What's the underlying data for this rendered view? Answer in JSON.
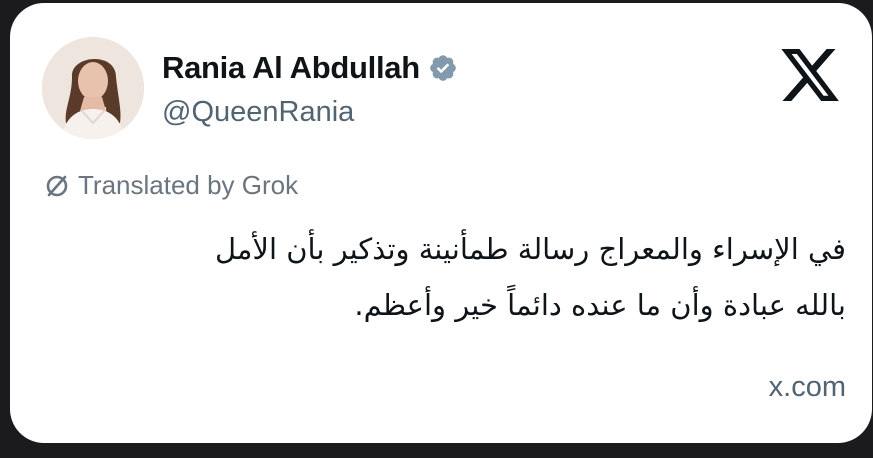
{
  "tweet_card": {
    "author": {
      "display_name": "Rania Al Abdullah",
      "handle": "@QueenRania",
      "verified_icon": "verified-badge-icon",
      "avatar": "profile-photo"
    },
    "platform_logo": "x-logo-icon",
    "translation": {
      "icon": "translate-icon",
      "label": "Translated by Grok"
    },
    "text_lines": [
      "في الإسراء والمعراج رسالة طمأنينة وتذكير بأن الأمل",
      "بالله عبادة وأن ما عنده دائماً خير وأعظم."
    ],
    "source": "x.com"
  },
  "colors": {
    "card_background": "#ffffff",
    "page_background": "#1b1b1d",
    "primary_text": "#0f1419",
    "secondary_text": "#536471",
    "verified_badge": "#829aab"
  }
}
